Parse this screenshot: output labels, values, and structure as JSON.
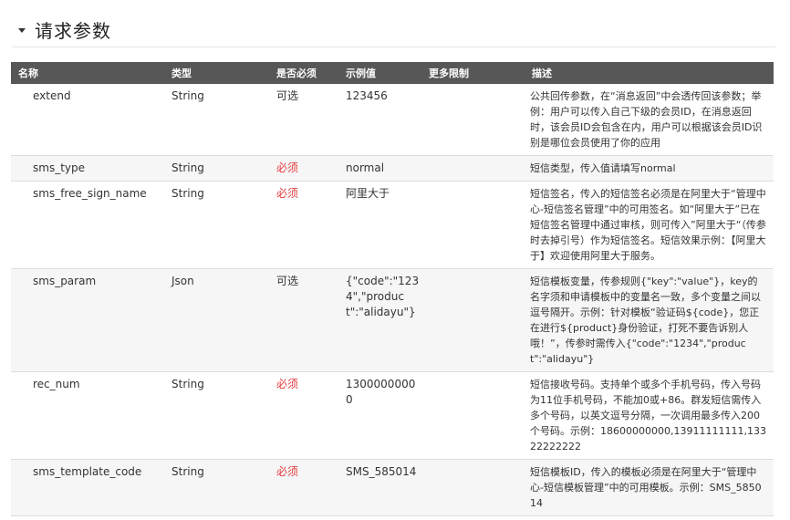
{
  "section": {
    "title": "请求参数"
  },
  "table": {
    "headers": [
      "名称",
      "类型",
      "是否必须",
      "示例值",
      "更多限制",
      "描述"
    ],
    "rows": [
      {
        "name": "extend",
        "type": "String",
        "required": "可选",
        "example": "123456",
        "more": "",
        "desc": "公共回传参数，在“消息返回”中会透传回该参数；举例：用户可以传入自己下级的会员ID，在消息返回时，该会员ID会包含在内，用户可以根据该会员ID识别是哪位会员使用了你的应用"
      },
      {
        "name": "sms_type",
        "type": "String",
        "required": "必须",
        "example": "normal",
        "more": "",
        "desc": "短信类型，传入值请填写normal"
      },
      {
        "name": "sms_free_sign_name",
        "type": "String",
        "required": "必须",
        "example": "阿里大于",
        "more": "",
        "desc": "短信签名，传入的短信签名必须是在阿里大于“管理中心-短信签名管理”中的可用签名。如“阿里大于”已在短信签名管理中通过审核，则可传入”阿里大于“（传参时去掉引号）作为短信签名。短信效果示例：【阿里大于】欢迎使用阿里大于服务。"
      },
      {
        "name": "sms_param",
        "type": "Json",
        "required": "可选",
        "example": "{\"code\":\"1234\",\"product\":\"alidayu\"}",
        "more": "",
        "desc": "短信模板变量，传参规则{\"key\":\"value\"}，key的名字须和申请模板中的变量名一致，多个变量之间以逗号隔开。示例：针对模板“验证码${code}，您正在进行${product}身份验证，打死不要告诉别人哦！”，传参时需传入{\"code\":\"1234\",\"product\":\"alidayu\"}"
      },
      {
        "name": "rec_num",
        "type": "String",
        "required": "必须",
        "example": "13000000000",
        "more": "",
        "desc": "短信接收号码。支持单个或多个手机号码，传入号码为11位手机号码，不能加0或+86。群发短信需传入多个号码，以英文逗号分隔，一次调用最多传入200个号码。示例：18600000000,13911111111,13322222222"
      },
      {
        "name": "sms_template_code",
        "type": "String",
        "required": "必须",
        "example": "SMS_585014",
        "more": "",
        "desc": "短信模板ID，传入的模板必须是在阿里大于“管理中心-短信模板管理”中的可用模板。示例：SMS_585014"
      }
    ]
  },
  "colors": {
    "header_bg": "#575757",
    "header_text": "#ffffff",
    "required_red": "#e4393c",
    "alt_row_bg": "#f6f6f6"
  }
}
